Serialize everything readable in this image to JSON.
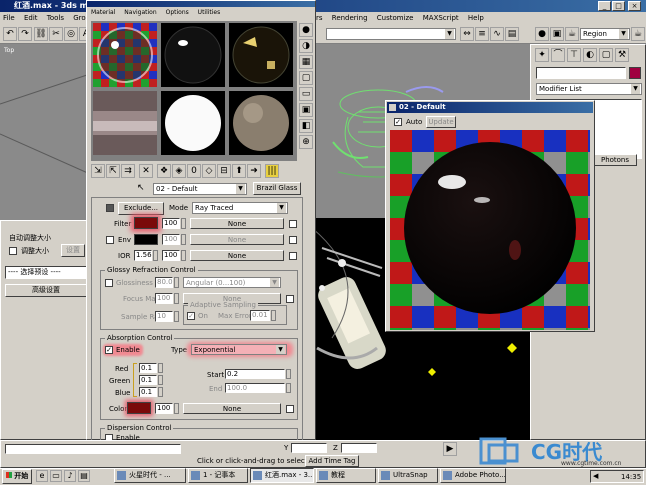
{
  "max_window": {
    "title": "红酒.max - 3ds max",
    "menu_left": [
      "File",
      "Edit",
      "Tools",
      "Group"
    ],
    "menu_right": [
      "rs",
      "Rendering",
      "Customize",
      "MAXScript",
      "Help"
    ],
    "viewport_label": "Top",
    "region_dropdown": "Region",
    "modifier_list": "Modifier List",
    "photons_label": "Photons"
  },
  "material_editor": {
    "menu": [
      "Material",
      "Navigation",
      "Options",
      "Utilities"
    ],
    "material_name": "02 - Default",
    "material_type": "Brazil Glass",
    "exclude_label": "Exclude...",
    "mode_label": "Mode",
    "mode_value": "Ray Traced",
    "filter_label": "Filter",
    "filter_value": "100",
    "none": "None",
    "env_label": "Env",
    "env_value": "100",
    "ior_label": "IOR",
    "ior_value": "1.56",
    "ior_amount": "100",
    "glossy_group": "Glossy Refraction Control",
    "glossiness_label": "Glossiness",
    "glossiness_value": "80.0",
    "angular_value": "Angular (0...100)",
    "focus_map_label": "Focus Map",
    "focus_map_value": "100",
    "adaptive_group": "Adaptive Sampling",
    "sample_rate_label": "Sample Rate",
    "sample_rate_value": "10",
    "on_label": "On",
    "max_error_label": "Max Error",
    "max_error_value": "0.01",
    "absorption_group": "Absorption Control",
    "enable_label": "Enable",
    "type_label": "Type",
    "type_value": "Exponential",
    "red_label": "Red",
    "red_value": "0.1",
    "green_label": "Green",
    "green_value": "0.1",
    "blue_label": "Blue",
    "blue_value": "0.1",
    "start_label": "Start",
    "start_value": "0.2",
    "end_label": "End",
    "end_value": "100.0",
    "color_label": "Color",
    "color_value": "100",
    "dispersion_group": "Dispersion Control",
    "dispersion_enable": "Enable"
  },
  "preview_window": {
    "title": "02 - Default",
    "auto_label": "Auto",
    "update_label": "Update"
  },
  "left_panel": {
    "auto_adjust": "自动调整大小",
    "adjust_size": "调整大小",
    "settings_btn": "设置",
    "select_preset": "---- 选择预设 ----",
    "advanced": "高级设置"
  },
  "status_bar": {
    "prompt": "Click or click-and-drag to select ob",
    "add_time_tag": "Add Time Tag",
    "y_label": "Y",
    "z_label": "Z"
  },
  "taskbar": {
    "start": "开始",
    "items": [
      "火星时代 - ...",
      "1 - 记事本",
      "红酒.max - 3...",
      "教程",
      "UltraSnap",
      "Adobe Photo..."
    ],
    "clock": "14:35"
  },
  "watermark": {
    "cg_text": "CG时代",
    "url": "www.cgtime.com.cn"
  },
  "colors": {
    "filter_swatch": "#7a0a0a",
    "env_swatch": "#000000",
    "absorb_swatch": "#7a0a0a",
    "highlight": "#e85a6a",
    "title_blue": "#0a246a"
  }
}
